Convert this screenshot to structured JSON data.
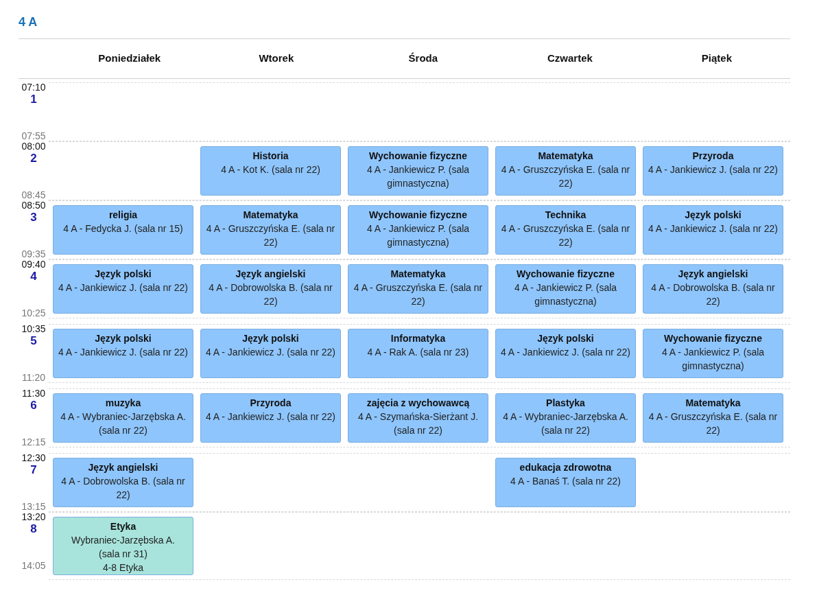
{
  "title": "4 A",
  "days": [
    "Poniedziałek",
    "Wtorek",
    "Środa",
    "Czwartek",
    "Piątek"
  ],
  "periods": [
    {
      "number": "1",
      "start": "07:10",
      "end": "07:55",
      "lessons": [
        {
          "kind": "empty"
        },
        {
          "kind": "empty"
        },
        {
          "kind": "empty"
        },
        {
          "kind": "empty"
        },
        {
          "kind": "empty"
        }
      ]
    },
    {
      "number": "2",
      "start": "08:00",
      "end": "08:45",
      "lessons": [
        {
          "kind": "empty"
        },
        {
          "kind": "lesson",
          "subject": "Historia",
          "details": [
            "4 A - Kot K. (sala nr 22)"
          ],
          "color": "#8ec5fc"
        },
        {
          "kind": "lesson",
          "subject": "Wychowanie fizyczne",
          "details": [
            "4 A - Jankiewicz P. (sala gimnastyczna)"
          ],
          "color": "#8ec5fc"
        },
        {
          "kind": "lesson",
          "subject": "Matematyka",
          "details": [
            "4 A - Gruszczyńska E. (sala nr 22)"
          ],
          "color": "#8ec5fc"
        },
        {
          "kind": "lesson",
          "subject": "Przyroda",
          "details": [
            "4 A - Jankiewicz J. (sala nr 22)"
          ],
          "color": "#8ec5fc"
        }
      ]
    },
    {
      "number": "3",
      "start": "08:50",
      "end": "09:35",
      "lessons": [
        {
          "kind": "lesson",
          "subject": "religia",
          "details": [
            "4 A - Fedycka J. (sala nr 15)"
          ],
          "color": "#8ec5fc"
        },
        {
          "kind": "lesson",
          "subject": "Matematyka",
          "details": [
            "4 A - Gruszczyńska E. (sala nr 22)"
          ],
          "color": "#8ec5fc"
        },
        {
          "kind": "lesson",
          "subject": "Wychowanie fizyczne",
          "details": [
            "4 A - Jankiewicz P. (sala gimnastyczna)"
          ],
          "color": "#8ec5fc"
        },
        {
          "kind": "lesson",
          "subject": "Technika",
          "details": [
            "4 A - Gruszczyńska E. (sala nr 22)"
          ],
          "color": "#8ec5fc"
        },
        {
          "kind": "lesson",
          "subject": "Język polski",
          "details": [
            "4 A - Jankiewicz J. (sala nr 22)"
          ],
          "color": "#8ec5fc"
        }
      ]
    },
    {
      "number": "4",
      "start": "09:40",
      "end": "10:25",
      "lessons": [
        {
          "kind": "lesson",
          "subject": "Język polski",
          "details": [
            "4 A - Jankiewicz J. (sala nr 22)"
          ],
          "color": "#8ec5fc"
        },
        {
          "kind": "lesson",
          "subject": "Język angielski",
          "details": [
            "4 A - Dobrowolska B. (sala nr 22)"
          ],
          "color": "#8ec5fc"
        },
        {
          "kind": "lesson",
          "subject": "Matematyka",
          "details": [
            "4 A - Gruszczyńska E. (sala nr 22)"
          ],
          "color": "#8ec5fc"
        },
        {
          "kind": "lesson",
          "subject": "Wychowanie fizyczne",
          "details": [
            "4 A - Jankiewicz P. (sala gimnastyczna)"
          ],
          "color": "#8ec5fc"
        },
        {
          "kind": "lesson",
          "subject": "Język angielski",
          "details": [
            "4 A - Dobrowolska B. (sala nr 22)"
          ],
          "color": "#8ec5fc"
        }
      ]
    },
    {
      "number": "5",
      "start": "10:35",
      "end": "11:20",
      "lessons": [
        {
          "kind": "lesson",
          "subject": "Język polski",
          "details": [
            "4 A - Jankiewicz J. (sala nr 22)"
          ],
          "color": "#8ec5fc"
        },
        {
          "kind": "lesson",
          "subject": "Język polski",
          "details": [
            "4 A - Jankiewicz J. (sala nr 22)"
          ],
          "color": "#8ec5fc"
        },
        {
          "kind": "lesson",
          "subject": "Informatyka",
          "details": [
            "4 A - Rak A. (sala nr 23)"
          ],
          "color": "#8ec5fc"
        },
        {
          "kind": "lesson",
          "subject": "Język polski",
          "details": [
            "4 A - Jankiewicz J. (sala nr 22)"
          ],
          "color": "#8ec5fc"
        },
        {
          "kind": "lesson",
          "subject": "Wychowanie fizyczne",
          "details": [
            "4 A - Jankiewicz P. (sala gimnastyczna)"
          ],
          "color": "#8ec5fc"
        }
      ]
    },
    {
      "number": "6",
      "start": "11:30",
      "end": "12:15",
      "lessons": [
        {
          "kind": "lesson",
          "subject": "muzyka",
          "details": [
            "4 A - Wybraniec-Jarzębska A. (sala nr 22)"
          ],
          "color": "#8ec5fc"
        },
        {
          "kind": "lesson",
          "subject": "Przyroda",
          "details": [
            "4 A - Jankiewicz J. (sala nr 22)"
          ],
          "color": "#8ec5fc"
        },
        {
          "kind": "lesson",
          "subject": "zajęcia z wychowawcą",
          "details": [
            "4 A - Szymańska-Sierżant J. (sala nr 22)"
          ],
          "color": "#8ec5fc"
        },
        {
          "kind": "lesson",
          "subject": "Plastyka",
          "details": [
            "4 A - Wybraniec-Jarzębska A. (sala nr 22)"
          ],
          "color": "#8ec5fc"
        },
        {
          "kind": "lesson",
          "subject": "Matematyka",
          "details": [
            "4 A - Gruszczyńska E. (sala nr 22)"
          ],
          "color": "#8ec5fc"
        }
      ]
    },
    {
      "number": "7",
      "start": "12:30",
      "end": "13:15",
      "lessons": [
        {
          "kind": "lesson",
          "subject": "Język angielski",
          "details": [
            "4 A - Dobrowolska B. (sala nr 22)"
          ],
          "color": "#8ec5fc"
        },
        {
          "kind": "empty"
        },
        {
          "kind": "empty"
        },
        {
          "kind": "lesson",
          "subject": "edukacja zdrowotna",
          "details": [
            "4 A - Banaś T. (sala nr 22)"
          ],
          "color": "#8ec5fc"
        },
        {
          "kind": "empty"
        }
      ]
    },
    {
      "number": "8",
      "start": "13:20",
      "end": "14:05",
      "lessons": [
        {
          "kind": "lesson",
          "subject": "Etyka",
          "details": [
            "Wybraniec-Jarzębska A.",
            "(sala nr 31)",
            "4-8 Etyka"
          ],
          "color": "#a8e4dc"
        },
        {
          "kind": "empty"
        },
        {
          "kind": "empty"
        },
        {
          "kind": "empty"
        },
        {
          "kind": "empty"
        }
      ]
    }
  ]
}
